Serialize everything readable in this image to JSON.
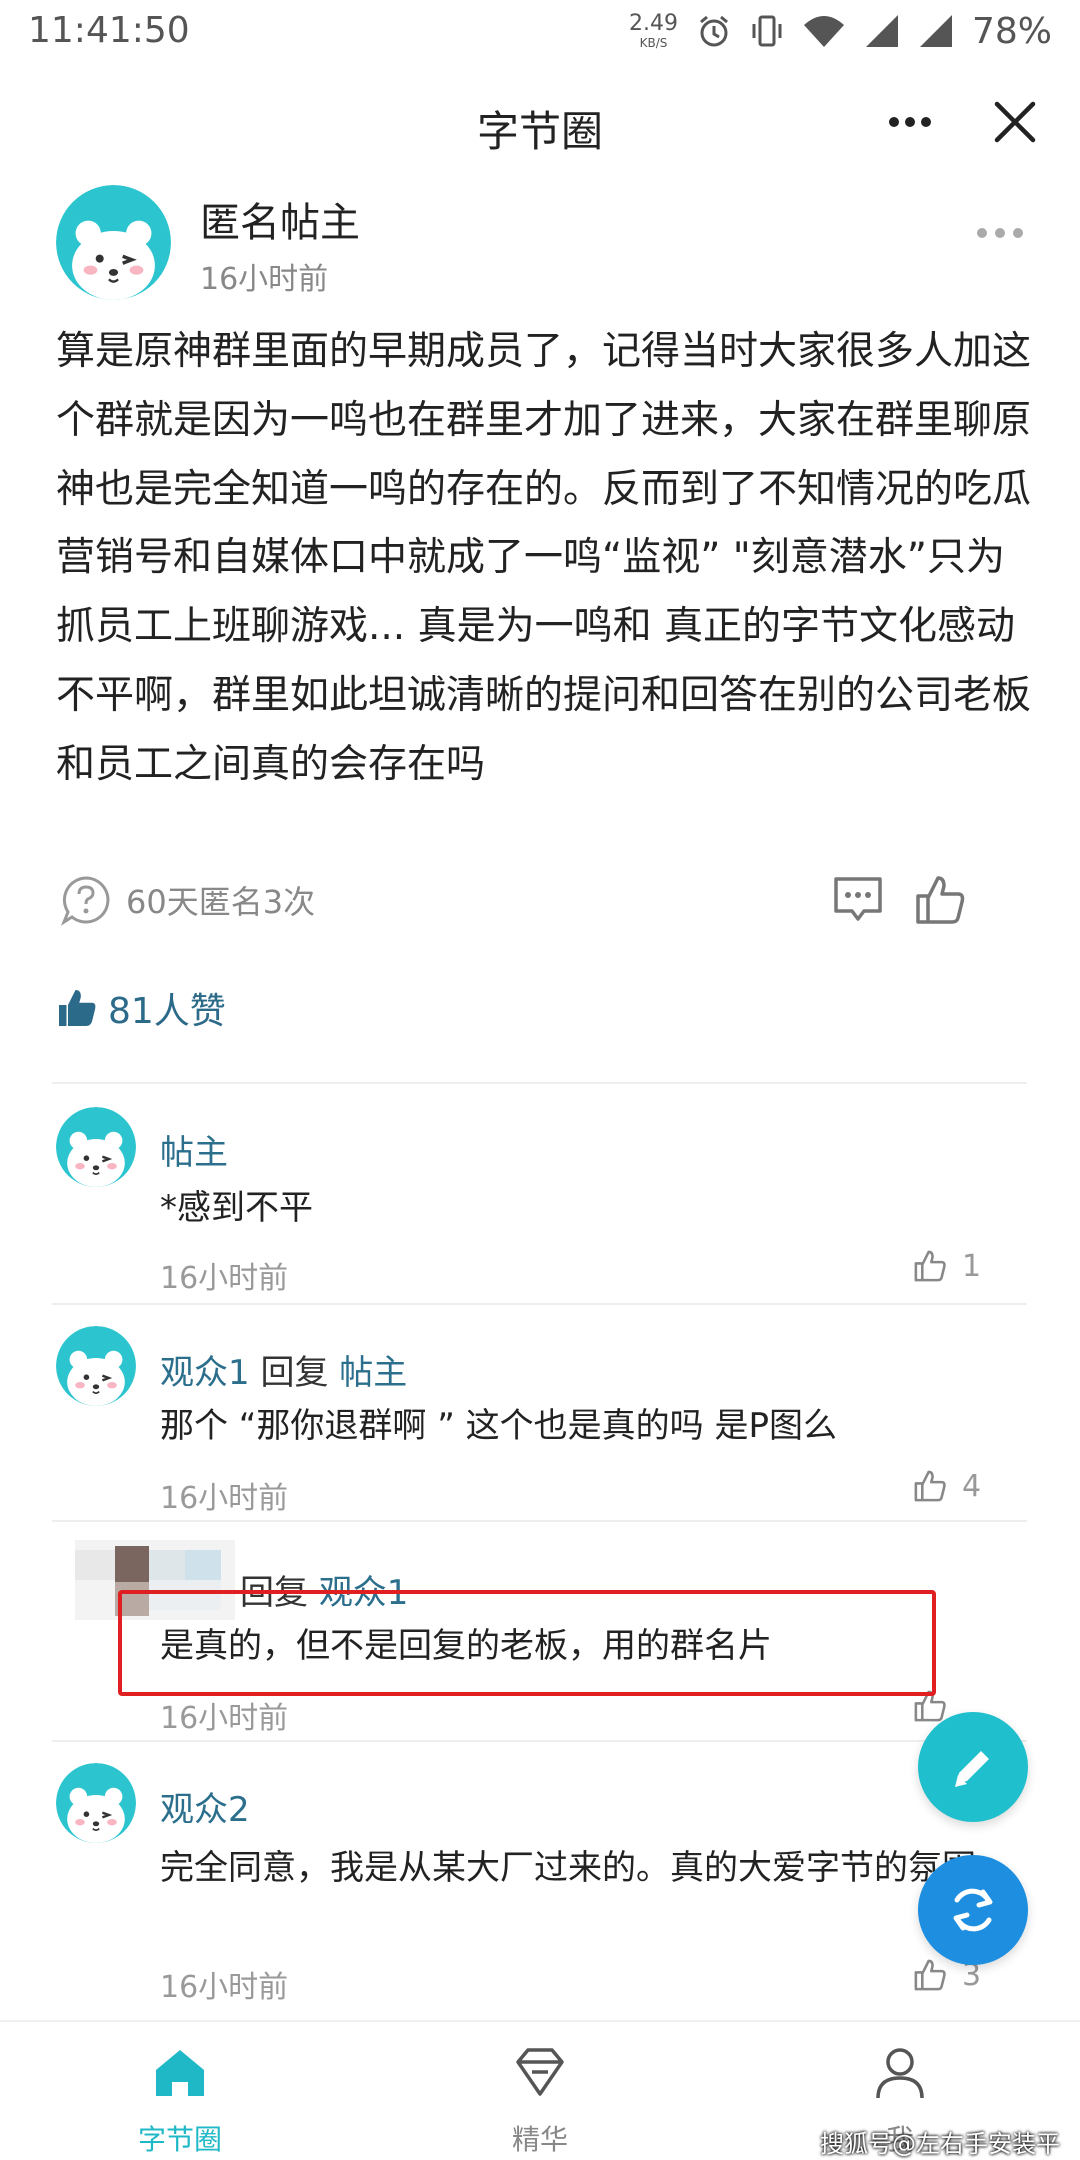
{
  "status_bar": {
    "time": "11:41:50",
    "net_speed_value": "2.49",
    "net_speed_unit": "KB/S",
    "battery": "78%"
  },
  "header": {
    "title": "字节圈",
    "more_icon": "more-horizontal-icon",
    "close_icon": "close-icon"
  },
  "post": {
    "author": "匿名帖主",
    "time": "16小时前",
    "body": "算是原神群里面的早期成员了，记得当时大家很多人加这个群就是因为一鸣也在群里才加了进来，大家在群里聊原神也是完全知道一鸣的存在的。反而到了不知情况的吃瓜营销号和自媒体口中就成了一鸣“监视” \"刻意潜水”只为抓员工上班聊游戏... 真是为一鸣和 真正的字节文化感动不平啊，群里如此坦诚清晰的提问和回答在别的公司老板和员工之间真的会存在吗",
    "quota_text": "60天匿名3次",
    "likes_text": "81人赞"
  },
  "comments": [
    {
      "name": "帖主",
      "reply_word": "",
      "reply_to": "",
      "text": "*感到不平",
      "time": "16小时前",
      "likes": "1"
    },
    {
      "name": "观众1",
      "reply_word": "回复",
      "reply_to": "帖主",
      "text": "那个 “那你退群啊 ” 这个也是真的吗 是P图么",
      "time": "16小时前",
      "likes": "4"
    },
    {
      "name": "",
      "reply_word": "回复",
      "reply_to": "观众1",
      "text": "是真的，但不是回复的老板，用的群名片",
      "time": "16小时前",
      "likes": ""
    },
    {
      "name": "观众2",
      "reply_word": "",
      "reply_to": "",
      "text": "完全同意，我是从某大厂过来的。真的大爱字节的氛围",
      "time": "16小时前",
      "likes": "3"
    }
  ],
  "bottom_nav": [
    {
      "label": "字节圈",
      "icon": "home-icon",
      "active": true
    },
    {
      "label": "精华",
      "icon": "diamond-icon",
      "active": false
    },
    {
      "label": "我",
      "icon": "person-icon",
      "active": false
    }
  ],
  "source_watermark": "搜狐号@左右手安装平台",
  "colors": {
    "accent": "#1fb8c6",
    "name_blue": "#2b6f8d",
    "highlight_red": "#e02020",
    "refresh_blue": "#1e8fe0"
  }
}
